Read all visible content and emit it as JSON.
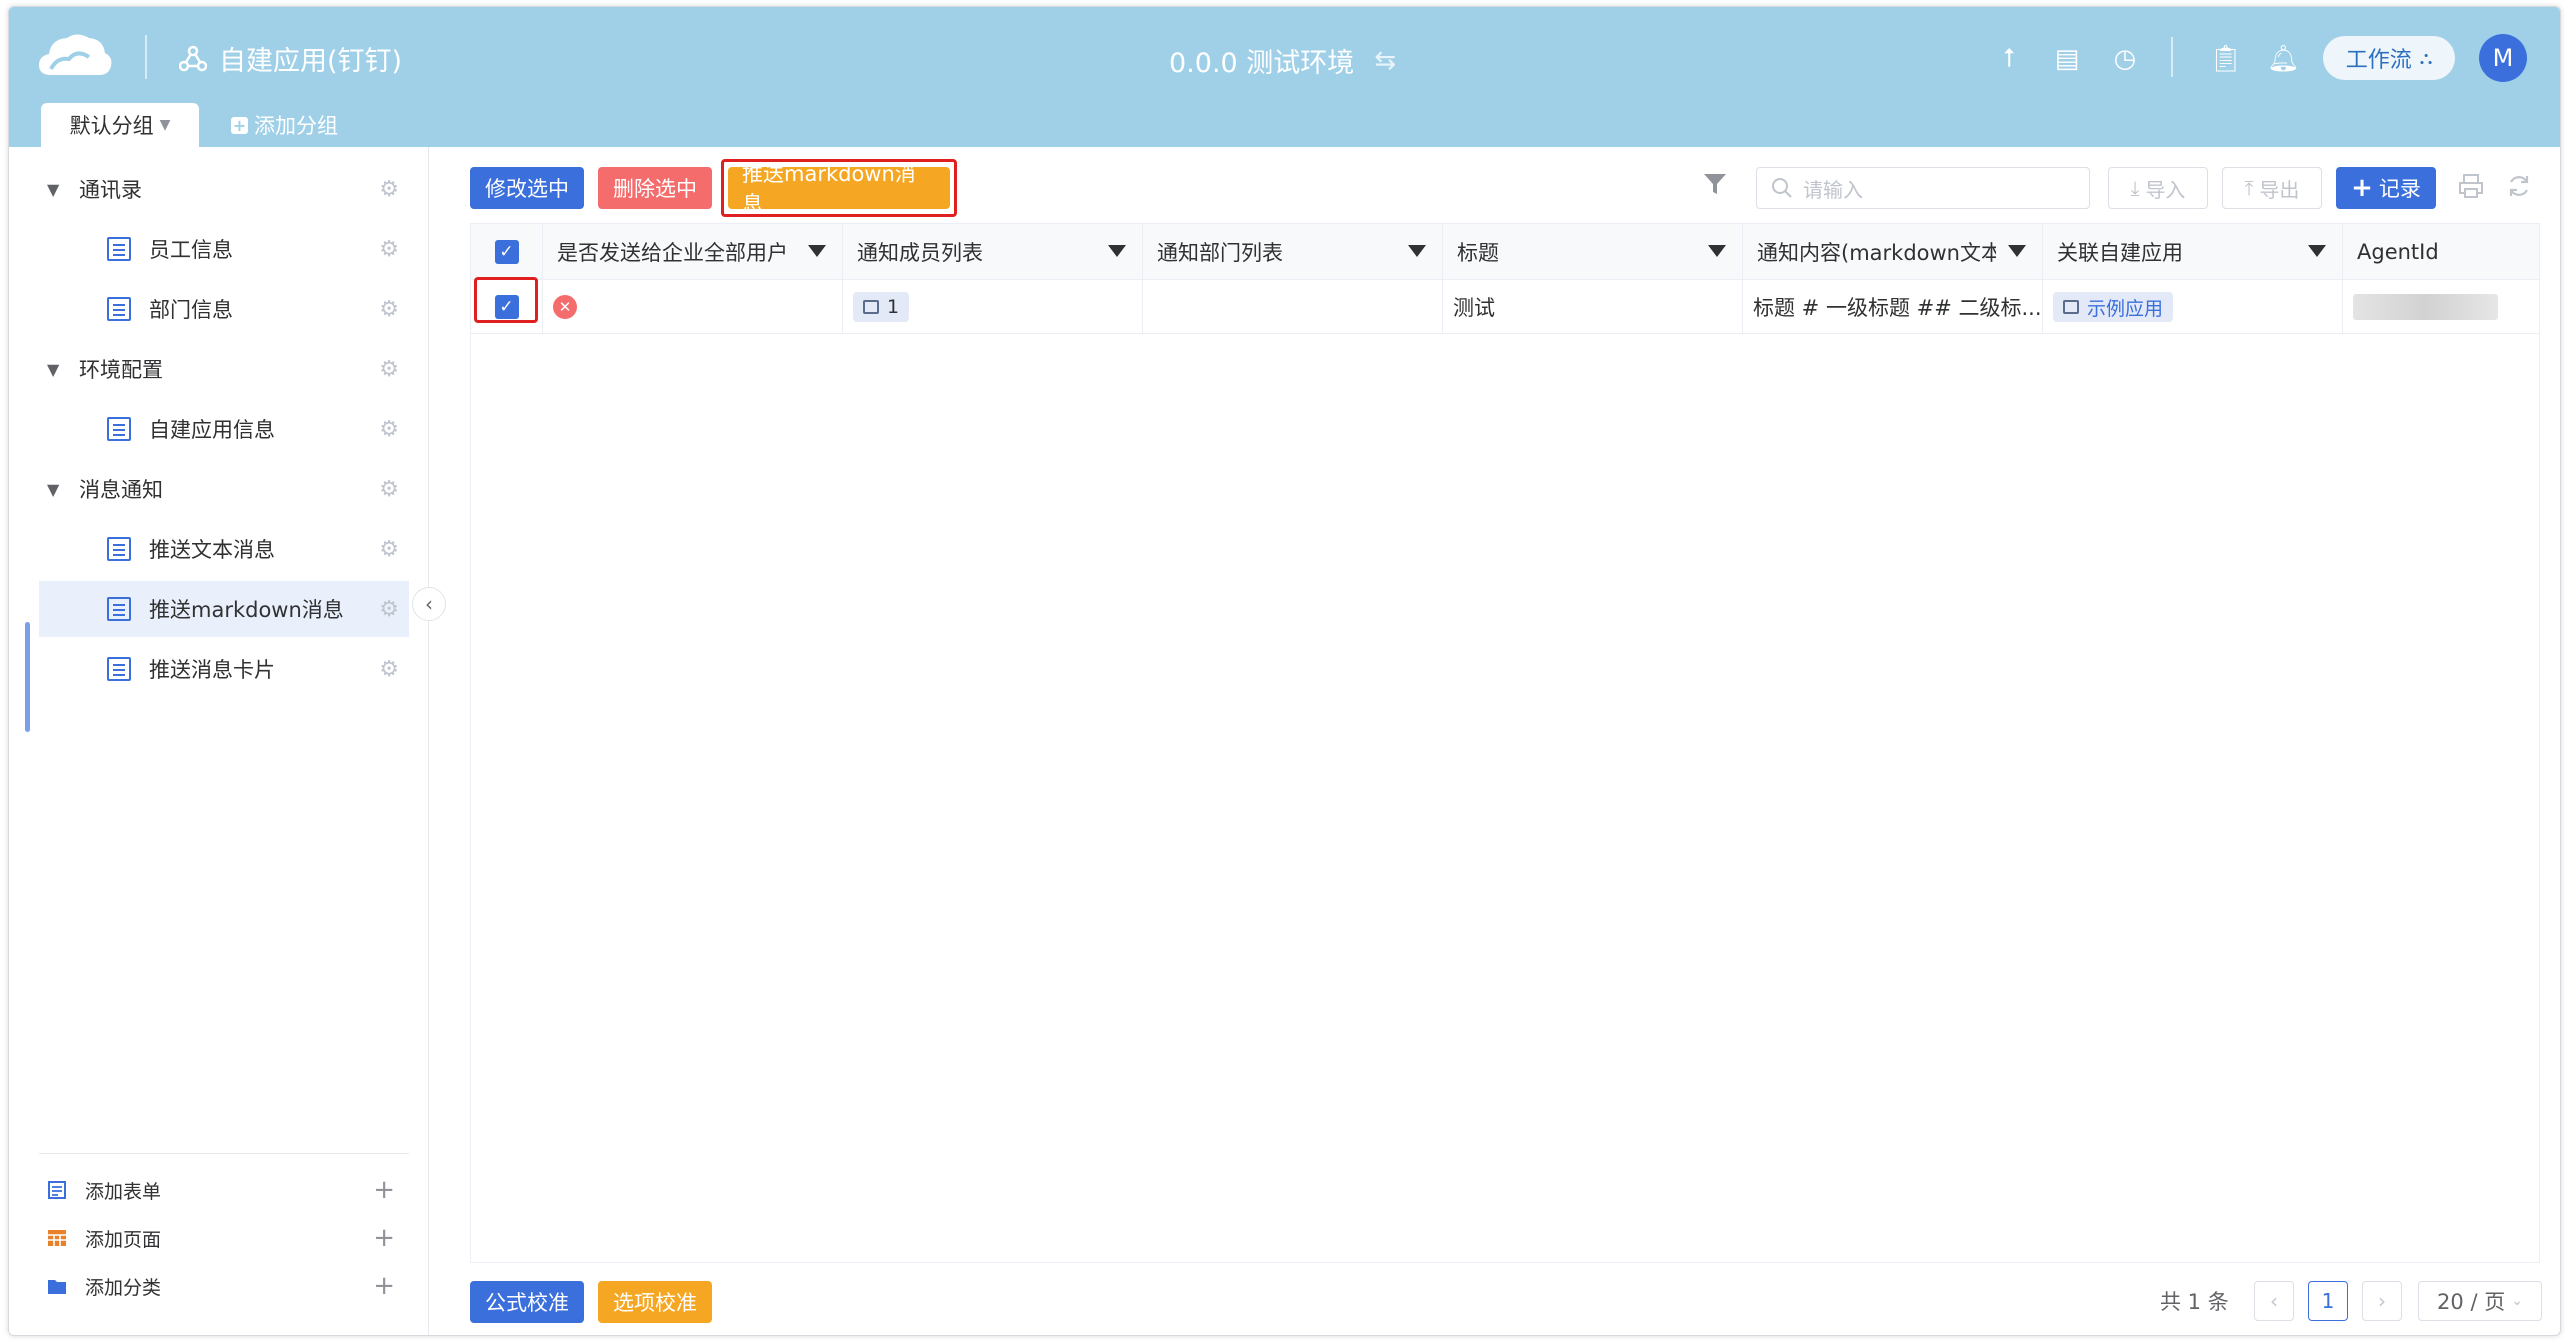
{
  "header": {
    "app_title": "自建应用(钉钉)",
    "env_title": "0.0.0 测试环境",
    "workflow_label": "工作流",
    "avatar_initial": "M",
    "colors": {
      "bar": "#a0d0e8",
      "accent": "#3a6fdc"
    }
  },
  "groups": {
    "current": "默认分组",
    "add_label": "添加分组"
  },
  "sidebar": {
    "items": [
      {
        "label": "通讯录",
        "type": "folder"
      },
      {
        "label": "员工信息",
        "type": "form"
      },
      {
        "label": "部门信息",
        "type": "form"
      },
      {
        "label": "环境配置",
        "type": "folder"
      },
      {
        "label": "自建应用信息",
        "type": "form"
      },
      {
        "label": "消息通知",
        "type": "folder"
      },
      {
        "label": "推送文本消息",
        "type": "form"
      },
      {
        "label": "推送markdown消息",
        "type": "form",
        "active": true
      },
      {
        "label": "推送消息卡片",
        "type": "form"
      }
    ],
    "bottom": [
      {
        "label": "添加表单",
        "icon": "form-icon"
      },
      {
        "label": "添加页面",
        "icon": "page-icon"
      },
      {
        "label": "添加分类",
        "icon": "folder-icon"
      }
    ]
  },
  "toolbar": {
    "edit_selected": "修改选中",
    "delete_selected": "删除选中",
    "push_markdown": "推送markdown消息",
    "search_placeholder": "请输入",
    "import_label": "导入",
    "export_label": "导出",
    "add_record_label": "记录"
  },
  "table": {
    "columns": [
      "是否发送给企业全部用户",
      "通知成员列表",
      "通知部门列表",
      "标题",
      "通知内容(markdown文本)",
      "关联自建应用",
      "AgentId"
    ],
    "rows": [
      {
        "checked": true,
        "send_all": false,
        "members_count": "1",
        "departments": "",
        "title": "测试",
        "content": "标题 # 一级标题 ## 二级标...",
        "app": "示例应用",
        "agent_id": ""
      }
    ]
  },
  "footer": {
    "formula_check": "公式校准",
    "option_check": "选项校准",
    "total": "共 1 条",
    "current_page": "1",
    "page_size": "20 / 页"
  }
}
